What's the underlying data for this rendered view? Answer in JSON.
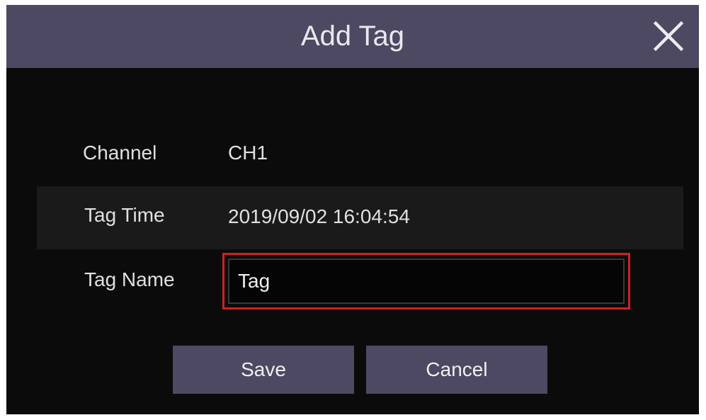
{
  "dialog": {
    "title": "Add Tag",
    "close_icon": "close-icon"
  },
  "fields": {
    "channel": {
      "label": "Channel",
      "value": "CH1"
    },
    "tag_time": {
      "label": "Tag Time",
      "value": "2019/09/02 16:04:54"
    },
    "tag_name": {
      "label": "Tag Name",
      "value": "Tag"
    }
  },
  "buttons": {
    "save_label": "Save",
    "cancel_label": "Cancel"
  },
  "colors": {
    "titlebar": "#4d4962",
    "background": "#0b0b0b",
    "highlight": "#d11f24",
    "button": "#4d4962"
  }
}
